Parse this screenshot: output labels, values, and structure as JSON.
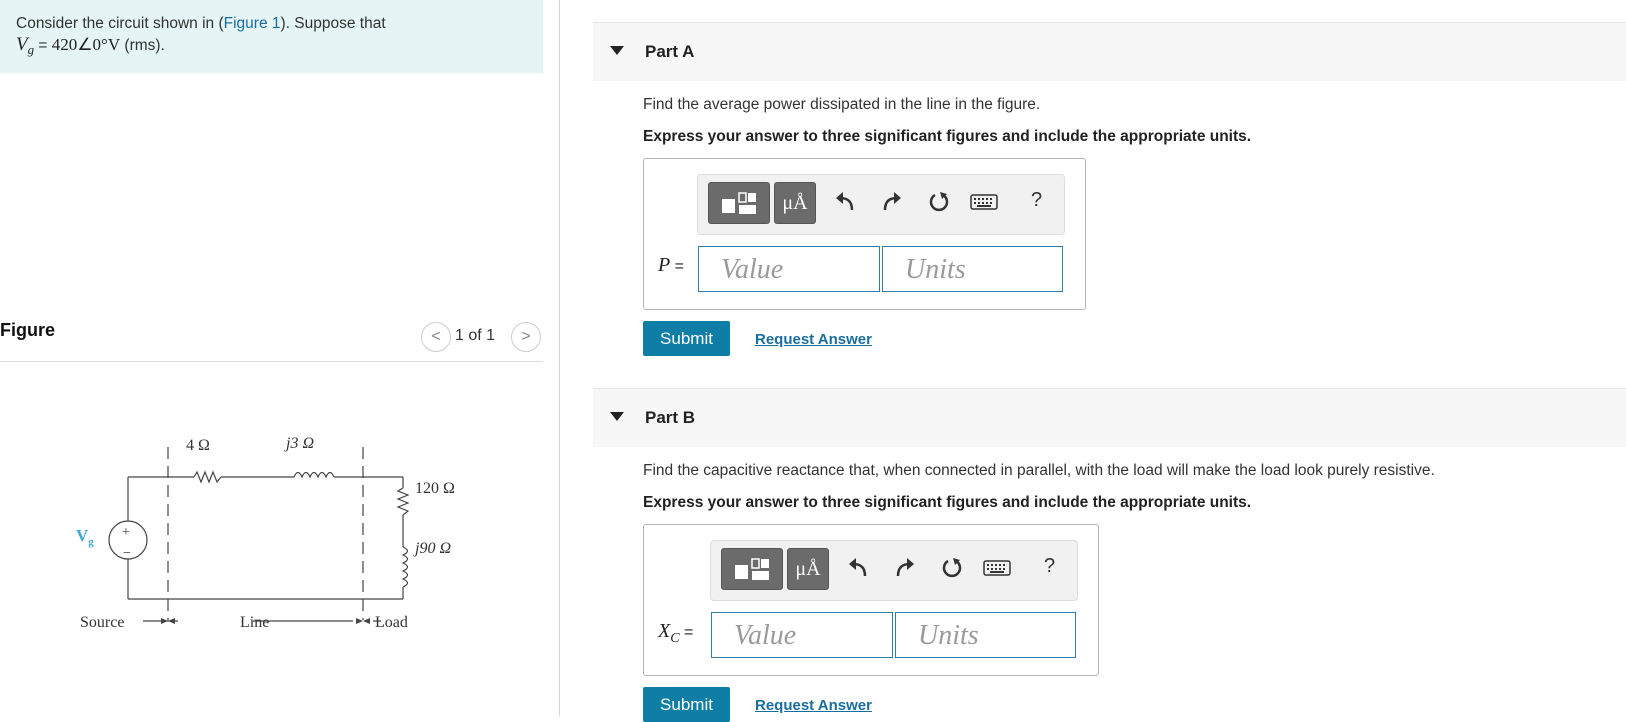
{
  "intro": {
    "line1_pre": "Consider the circuit shown in (",
    "figure_link": "Figure 1",
    "line1_post": "). Suppose that",
    "var": "V",
    "var_sub": "g",
    "eq": " = ",
    "value": "420∠0°V",
    "unit_note": " (rms)."
  },
  "figure": {
    "title": "Figure",
    "pager": "1 of 1",
    "prev_glyph": "<",
    "next_glyph": ">",
    "circuit": {
      "r_line": "4 Ω",
      "x_line": "j3 Ω",
      "r_load": "120 Ω",
      "x_load": "j90 Ω",
      "source_label": "V",
      "source_sub": "g",
      "plus": "+",
      "minus": "−",
      "seg_source": "Source",
      "seg_line": "Line",
      "seg_load": "Load"
    }
  },
  "toolbar": {
    "units_glyph": "μÅ",
    "help": "?"
  },
  "parts": [
    {
      "title": "Part A",
      "question": "Find the average power dissipated in the line in the figure.",
      "instruction": "Express your answer to three significant figures and include the appropriate units.",
      "var": "P",
      "var_sub": "",
      "eq": " =",
      "value_placeholder": "Value",
      "units_placeholder": "Units",
      "submit": "Submit",
      "request": "Request Answer"
    },
    {
      "title": "Part B",
      "question": "Find the capacitive reactance that, when connected in parallel, with the load will make the load look purely resistive.",
      "instruction": "Express your answer to three significant figures and include the appropriate units.",
      "var": "X",
      "var_sub": "C",
      "eq": " =",
      "value_placeholder": "Value",
      "units_placeholder": "Units",
      "submit": "Submit",
      "request": "Request Answer"
    }
  ],
  "colors": {
    "intro_bg": "#e5f4f4",
    "submit_bg": "#0f7ea6",
    "link": "#1a6e9e",
    "field_border": "#2f7ea8",
    "source_label": "#3fa9d6"
  }
}
